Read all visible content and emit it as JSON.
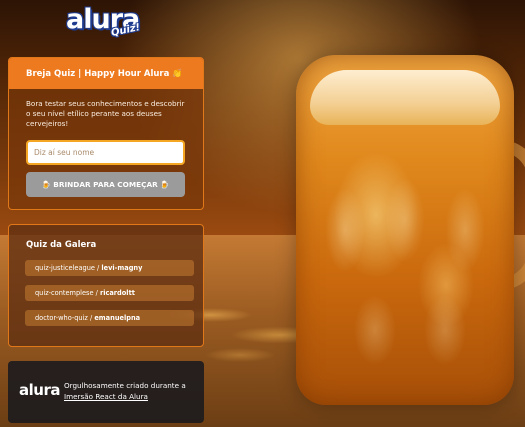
{
  "logo": {
    "text": "alura",
    "badge": "Quiz!"
  },
  "main_card": {
    "title": "Breja Quiz | Happy Hour Alura 👏",
    "description": "Bora testar seus conhecimentos e descobrir o seu nível etílico perante aos deuses cervejeiros!",
    "input_placeholder": "Diz aí seu nome",
    "button_label": "🍺 BRINDAR PARA COMEÇAR 🍺"
  },
  "galera_card": {
    "title": "Quiz da Galera",
    "quizzes": [
      {
        "project": "quiz-justiceleague",
        "user": "levi-magny"
      },
      {
        "project": "quiz-contemplese",
        "user": "ricardoltt"
      },
      {
        "project": "doctor-who-quiz",
        "user": "emanuelpna"
      }
    ]
  },
  "footer": {
    "logo": "alura",
    "text": "Orgulhosamente criado durante a",
    "link_text": "Imersão React da Alura"
  },
  "colors": {
    "accent": "#ee7a1f",
    "input_border": "#f5a623",
    "button_disabled": "#9b9b9b",
    "logo_outline": "#1e3b8f"
  }
}
